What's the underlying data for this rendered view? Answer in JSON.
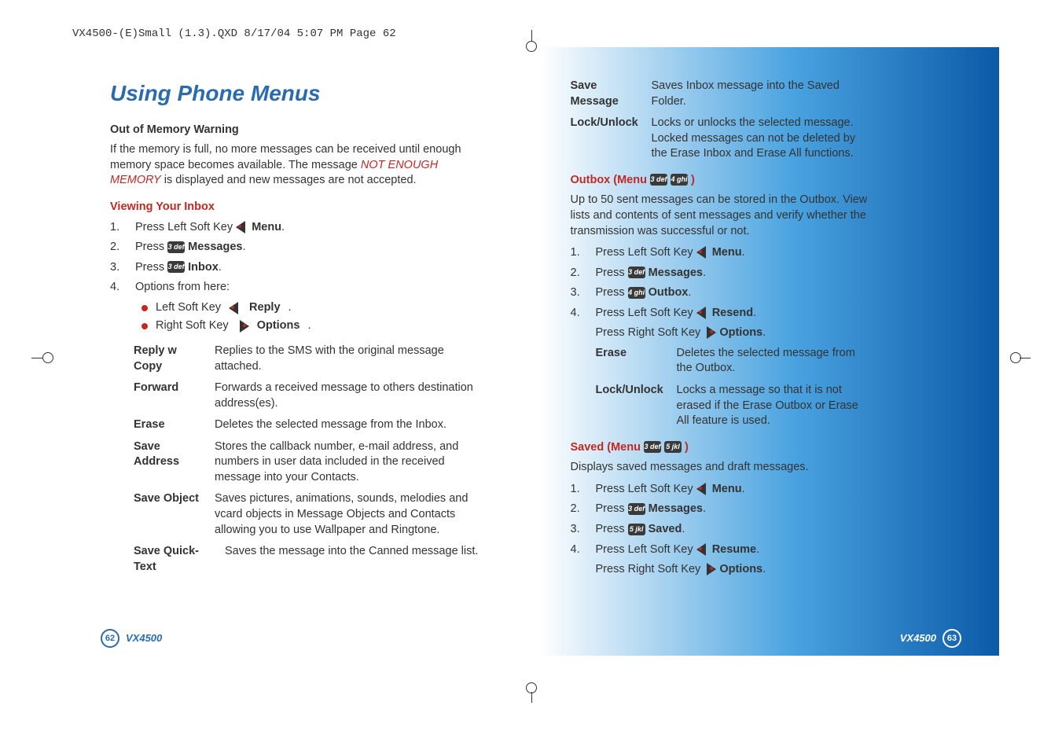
{
  "header_line": "VX4500-(E)Small (1.3).QXD  8/17/04  5:07 PM  Page 62",
  "title": "Using Phone Menus",
  "left": {
    "oom_heading": "Out of Memory Warning",
    "oom_para_pre": "If the memory is full, no more messages can be received until enough memory space becomes available. The message ",
    "oom_para_red": "NOT ENOUGH MEMORY",
    "oom_para_post": " is displayed and new messages are not accepted.",
    "inbox_heading": "Viewing Your Inbox",
    "step1_pre": "Press Left Soft Key ",
    "step1_bold": "Menu",
    "step2_pre": "Press ",
    "step2_bold": "Messages",
    "step3_pre": "Press ",
    "step3_bold": "Inbox",
    "step4": "Options from here:",
    "sub1_pre": "Left Soft Key ",
    "sub1_bold": "Reply",
    "sub2_pre": "Right Soft Key ",
    "sub2_bold": "Options",
    "defs": {
      "reply_w_copy": {
        "term": "Reply w Copy",
        "desc": "Replies to the SMS with the original message attached."
      },
      "forward": {
        "term": "Forward",
        "desc": "Forwards a received message to others destination address(es)."
      },
      "erase": {
        "term": "Erase",
        "desc": "Deletes the selected message from the Inbox."
      },
      "save_address": {
        "term": "Save Address",
        "desc": "Stores the callback number, e-mail address, and numbers in user data included in the received message into your Contacts."
      },
      "save_object": {
        "term": "Save Object",
        "desc": "Saves pictures, animations, sounds, melodies and vcard objects in Message Objects and Contacts allowing you to use Wallpaper and Ringtone."
      },
      "save_quick": {
        "term": "Save Quick-Text",
        "desc": "Saves the message into the Canned message list."
      }
    }
  },
  "right": {
    "defs_top": {
      "save_message": {
        "term": "Save Message",
        "desc": "Saves Inbox message into the Saved Folder."
      },
      "lock_unlock": {
        "term": "Lock/Unlock",
        "desc": "Locks or unlocks the selected message. Locked messages can not be deleted by the Erase Inbox and Erase All functions."
      }
    },
    "outbox_heading_pre": "Outbox (Menu ",
    "outbox_heading_post": " )",
    "outbox_para": "Up to 50 sent messages can be stored in the Outbox. View lists and contents of sent messages and verify whether the transmission was successful or not.",
    "o1_pre": "Press Left Soft Key ",
    "o1_bold": "Menu",
    "o2_pre": "Press ",
    "o2_bold": "Messages",
    "o3_pre": "Press ",
    "o3_bold": "Outbox",
    "o4_pre": "Press Left Soft Key ",
    "o4_bold": "Resend",
    "o4b_pre": "Press Right Soft Key ",
    "o4b_bold": "Options",
    "defs_out": {
      "erase": {
        "term": "Erase",
        "desc": "Deletes the selected message from the Outbox."
      },
      "lock_unlock": {
        "term": "Lock/Unlock",
        "desc": "Locks a message so that it is not erased if the Erase Outbox or Erase All feature is used."
      }
    },
    "saved_heading_pre": "Saved (Menu ",
    "saved_heading_post": " )",
    "saved_para": "Displays saved messages and draft messages.",
    "s1_pre": "Press Left Soft Key ",
    "s1_bold": "Menu",
    "s2_pre": "Press ",
    "s2_bold": "Messages",
    "s3_pre": "Press ",
    "s3_bold": "Saved",
    "s4_pre": "Press Left Soft Key ",
    "s4_bold": "Resume",
    "s4b_pre": "Press Right Soft Key ",
    "s4b_bold": "Options"
  },
  "keys": {
    "k3": "3 def",
    "k4": "4 ghi",
    "k5": "5 jkl"
  },
  "footer": {
    "left_num": "62",
    "right_num": "63",
    "model": "VX4500"
  },
  "nums": {
    "n1": "1.",
    "n2": "2.",
    "n3": "3.",
    "n4": "4."
  },
  "dots": {
    "period": "."
  }
}
